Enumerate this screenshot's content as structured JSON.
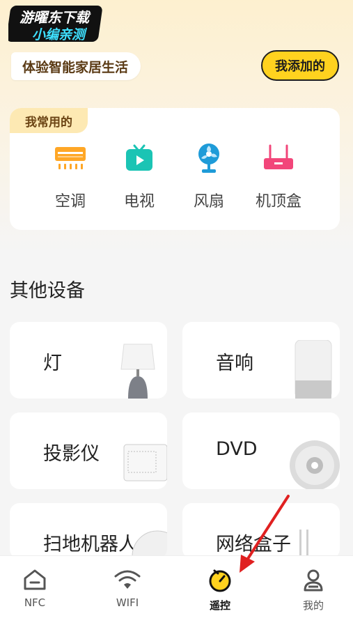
{
  "watermark": {
    "line1": "游曜东下载",
    "line2": "小编亲测"
  },
  "header": {
    "slogan": "体验智能家居生活",
    "added_button": "我添加的"
  },
  "favorites": {
    "tag": "我常用的",
    "items": [
      {
        "label": "空调",
        "icon": "air-conditioner-icon"
      },
      {
        "label": "电视",
        "icon": "tv-icon"
      },
      {
        "label": "风扇",
        "icon": "fan-icon"
      },
      {
        "label": "机顶盒",
        "icon": "set-top-box-icon"
      }
    ]
  },
  "other_devices": {
    "title": "其他设备",
    "items": [
      {
        "label": "灯"
      },
      {
        "label": "音响"
      },
      {
        "label": "投影仪"
      },
      {
        "label": "DVD"
      },
      {
        "label": "扫地机器人"
      },
      {
        "label": "网络盒子"
      }
    ]
  },
  "tabbar": {
    "items": [
      {
        "label": "NFC",
        "icon": "nfc-home-icon",
        "active": false
      },
      {
        "label": "WIFI",
        "icon": "wifi-icon",
        "active": false
      },
      {
        "label": "遥控",
        "icon": "remote-icon",
        "active": true
      },
      {
        "label": "我的",
        "icon": "profile-icon",
        "active": false
      }
    ]
  },
  "colors": {
    "accent": "#ffd21f",
    "annotation_arrow": "#e02020",
    "teal_icon": "#1bc4b4",
    "orange_icon": "#ffa726",
    "pink_icon": "#f2467a"
  }
}
